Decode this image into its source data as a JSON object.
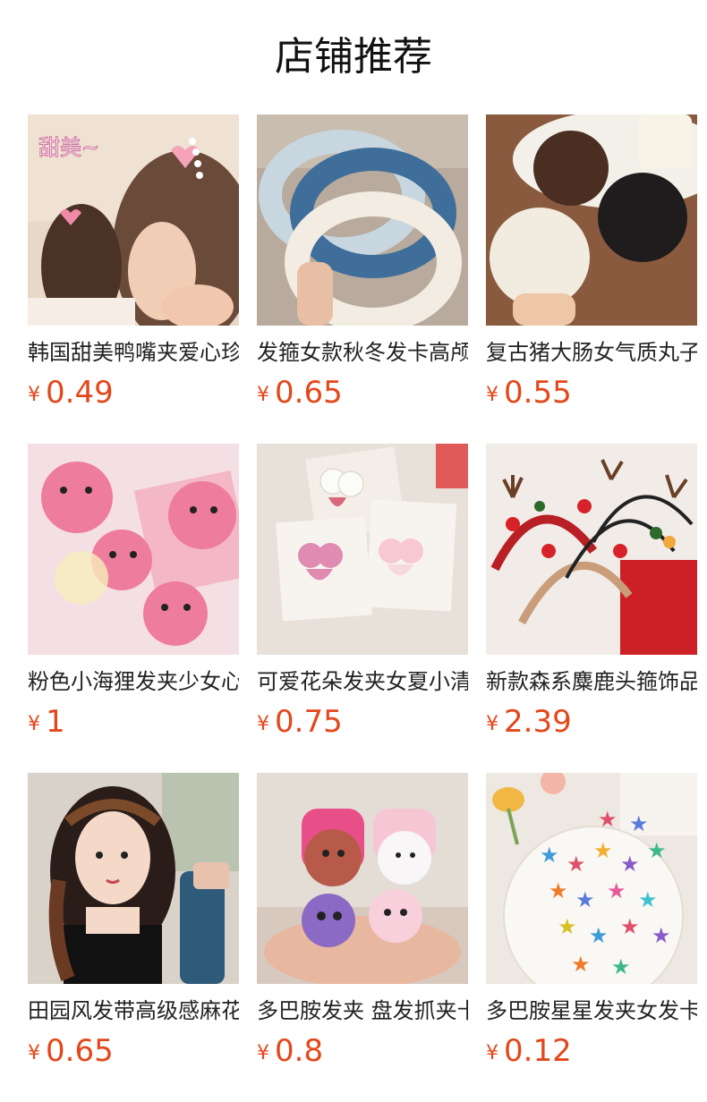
{
  "title": "店铺推荐",
  "currency_symbol": "¥",
  "accent_color": "#e4471a",
  "products": [
    {
      "name": "韩国甜美鸭嘴夹爱心珍珠发夹",
      "price": "0.49",
      "image_text": "甜美~"
    },
    {
      "name": "发箍女款秋冬发卡高颅顶发箍",
      "price": "0.65"
    },
    {
      "name": "复古猪大肠女气质丸子头发圈",
      "price": "0.55"
    },
    {
      "name": "粉色小海狸发夹少女心可爱",
      "price": "1"
    },
    {
      "name": "可爱花朵发夹女夏小清新",
      "price": "0.75"
    },
    {
      "name": "新款森系麋鹿头箍饰品圣诞",
      "price": "2.39"
    },
    {
      "name": "田园风发带高级感麻花辫发带",
      "price": "0.65"
    },
    {
      "name": "多巴胺发夹 盘发抓夹卡通",
      "price": "0.8"
    },
    {
      "name": "多巴胺星星发夹女发卡可爱",
      "price": "0.12"
    }
  ]
}
